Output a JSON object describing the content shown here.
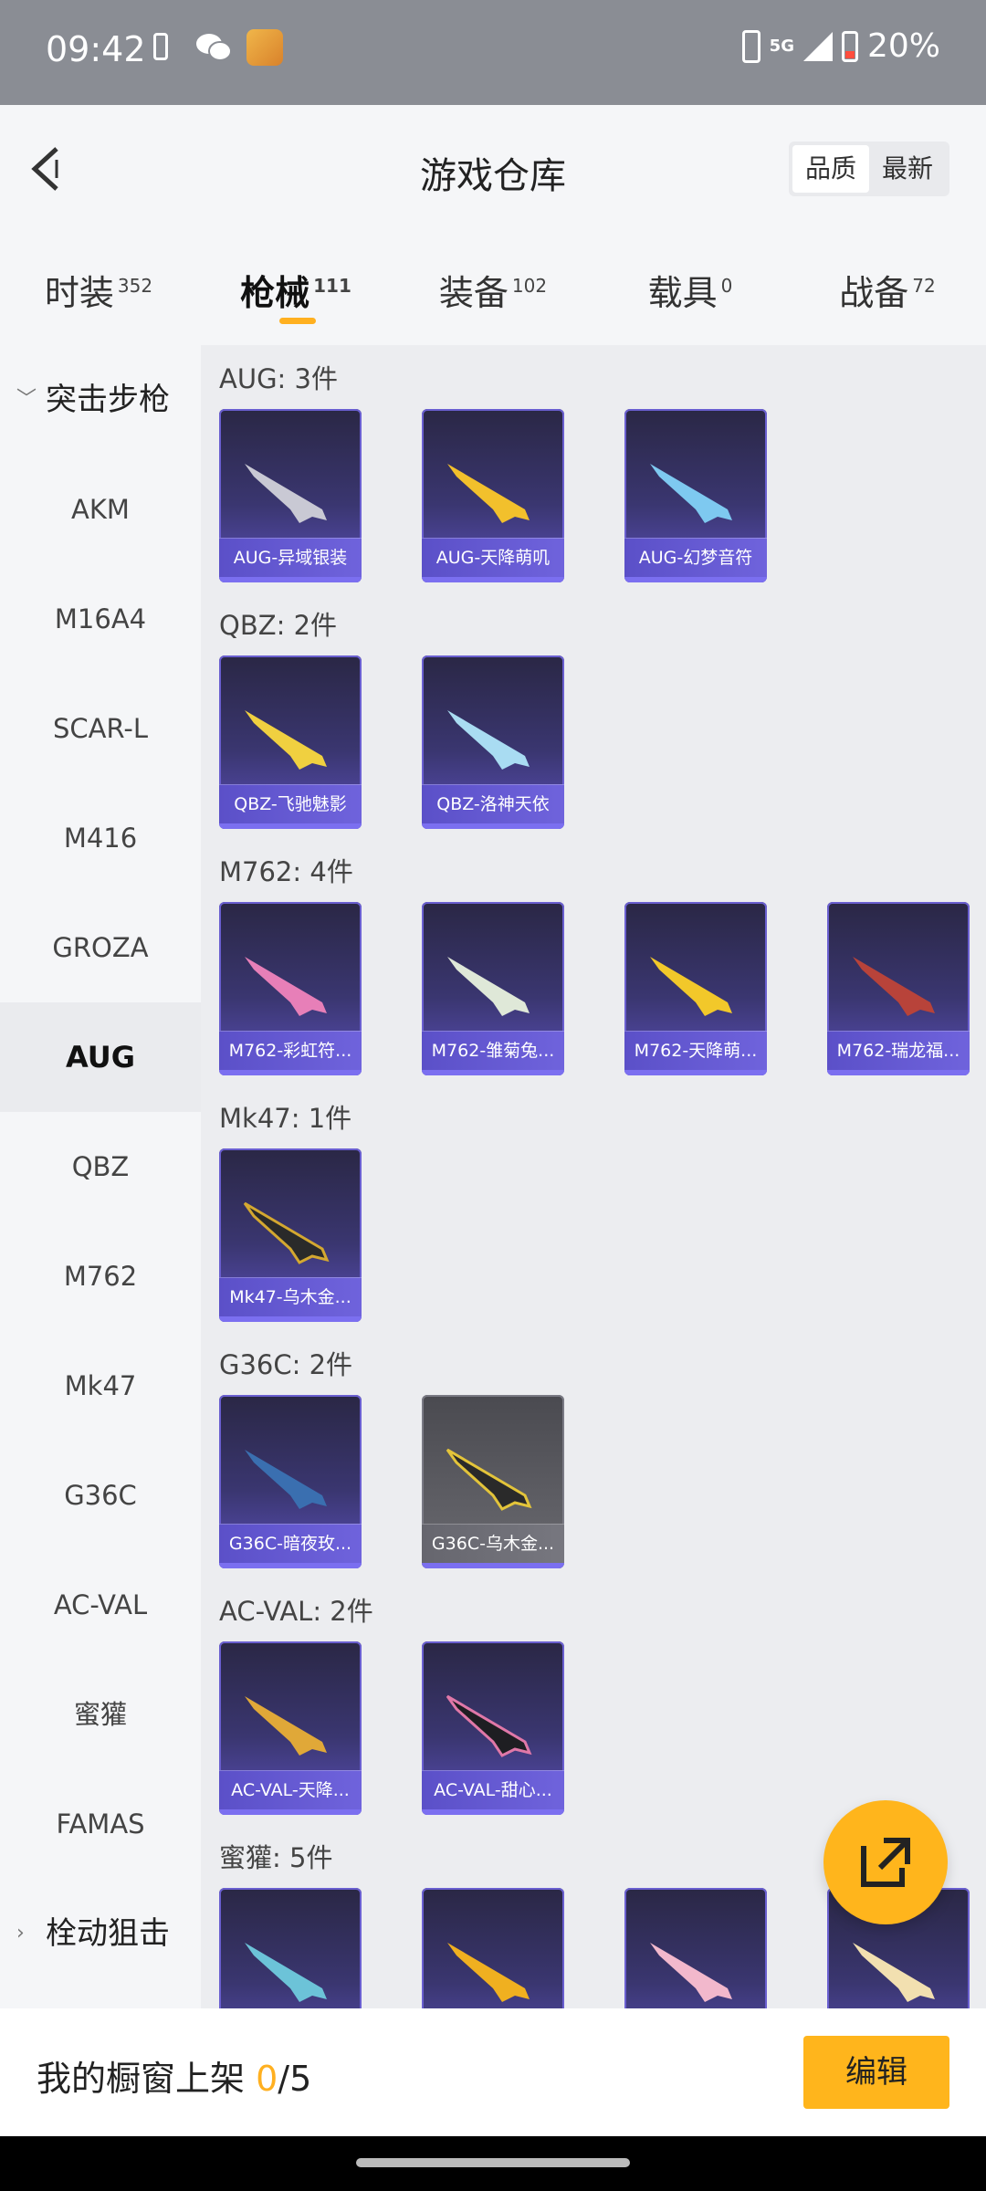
{
  "status_bar": {
    "time": "09:42",
    "network": "5G",
    "battery": "20%"
  },
  "header": {
    "title": "游戏仓库",
    "sort_options": [
      "品质",
      "最新"
    ],
    "active_sort": "品质"
  },
  "tabs": [
    {
      "label": "时装",
      "count": "352"
    },
    {
      "label": "枪械",
      "count": "111"
    },
    {
      "label": "装备",
      "count": "102"
    },
    {
      "label": "载具",
      "count": "0"
    },
    {
      "label": "战备",
      "count": "72"
    }
  ],
  "sidebar": {
    "group_open": "突击步枪",
    "items": [
      "AKM",
      "M16A4",
      "SCAR-L",
      "M416",
      "GROZA",
      "AUG",
      "QBZ",
      "M762",
      "Mk47",
      "G36C",
      "AC-VAL",
      "蜜獾",
      "FAMAS"
    ],
    "active_item": "AUG",
    "group_closed": "栓动狙击"
  },
  "groups": [
    {
      "title": "AUG: 3件",
      "cards": [
        "AUG-异域银装",
        "AUG-天降萌叽",
        "AUG-幻梦音符"
      ]
    },
    {
      "title": "QBZ: 2件",
      "cards": [
        "QBZ-飞驰魅影",
        "QBZ-洛神天依"
      ]
    },
    {
      "title": "M762: 4件",
      "cards": [
        "M762-彩虹符...",
        "M762-雏菊兔...",
        "M762-天降萌...",
        "M762-瑞龙福..."
      ]
    },
    {
      "title": "Mk47: 1件",
      "cards": [
        "Mk47-乌木金..."
      ]
    },
    {
      "title": "G36C: 2件",
      "cards": [
        "G36C-暗夜玫...",
        "G36C-乌木金..."
      ]
    },
    {
      "title": "AC-VAL: 2件",
      "cards": [
        "AC-VAL-天降...",
        "AC-VAL-甜心..."
      ]
    },
    {
      "title": "蜜獾: 5件",
      "cards": [
        "",
        "",
        "",
        ""
      ]
    }
  ],
  "bottom_bar": {
    "shelf_label": "我的橱窗上架",
    "shelf_current": "0",
    "shelf_total": "/5",
    "edit_label": "编辑"
  },
  "colors": {
    "accent": "#ffb51c",
    "card_bg": "#3a3670",
    "card_label": "#5b50c8"
  },
  "icons": [
    "back-icon",
    "share-icon",
    "wechat-icon",
    "signal-icon",
    "battery-icon"
  ]
}
